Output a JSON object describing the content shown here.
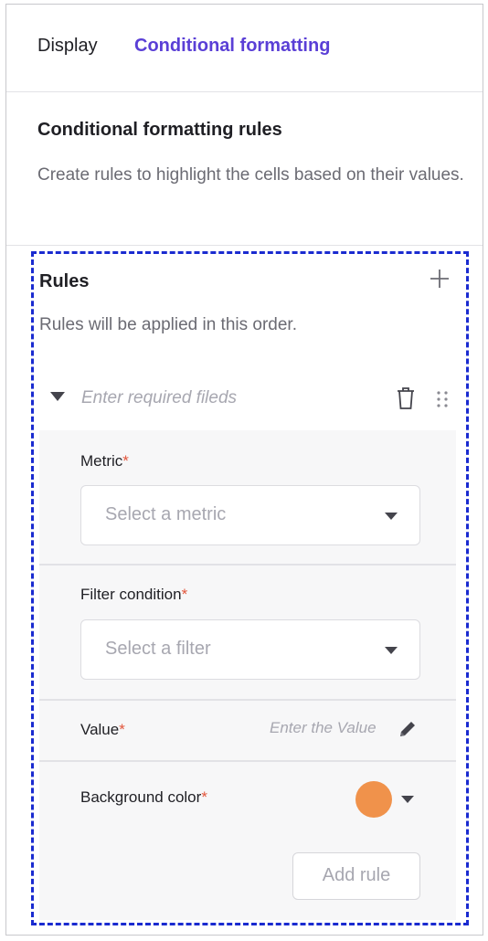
{
  "tabs": {
    "display": "Display",
    "conditional": "Conditional formatting"
  },
  "header": {
    "title": "Conditional formatting rules",
    "description": "Create rules to highlight the cells based on their values."
  },
  "rules": {
    "title": "Rules",
    "subtitle": "Rules will be applied in this order.",
    "rule": {
      "placeholder": "Enter required fileds",
      "metric": {
        "label": "Metric",
        "required": "*",
        "placeholder": "Select a metric"
      },
      "filter": {
        "label": "Filter condition",
        "required": "*",
        "placeholder": "Select a filter"
      },
      "value": {
        "label": "Value",
        "required": "*",
        "placeholder": "Enter the Value"
      },
      "background": {
        "label": "Background color",
        "required": "*",
        "color": "#f0924b"
      },
      "add_button": "Add rule"
    }
  },
  "colors": {
    "accent": "#5a3fd6",
    "required": "#e2563c",
    "highlight_border": "#1a2bd0"
  },
  "icons": [
    "plus-icon",
    "caret-down-icon",
    "trash-icon",
    "drag-handle-icon",
    "pencil-icon",
    "chevron-down-icon"
  ]
}
